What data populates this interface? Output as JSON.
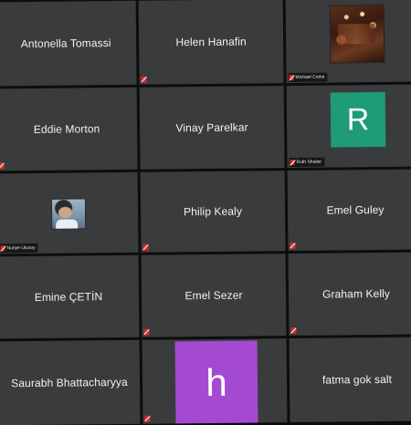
{
  "participants": [
    {
      "name": "Antonella Tomassi",
      "muted": false,
      "kind": "name"
    },
    {
      "name": "Helen Hanafin",
      "muted": true,
      "kind": "name"
    },
    {
      "name": "Michael Croke",
      "muted": true,
      "kind": "video"
    },
    {
      "name": "Eddie Morton",
      "muted": true,
      "kind": "name"
    },
    {
      "name": "Vinay Parelkar",
      "muted": false,
      "kind": "name"
    },
    {
      "name": "Ruth Shailer",
      "muted": true,
      "kind": "letter",
      "letter": "R",
      "color": "#1f9b78"
    },
    {
      "name": "Nuriye Ulusoy",
      "muted": true,
      "kind": "photo"
    },
    {
      "name": "Philip Kealy",
      "muted": true,
      "kind": "name"
    },
    {
      "name": "Emel Guley",
      "muted": true,
      "kind": "name"
    },
    {
      "name": "Emine ÇETİN",
      "muted": false,
      "kind": "name"
    },
    {
      "name": "Emel Sezer",
      "muted": true,
      "kind": "name"
    },
    {
      "name": "Graham Kelly",
      "muted": true,
      "kind": "name"
    },
    {
      "name": "Saurabh Bhattacharyya",
      "muted": false,
      "kind": "name"
    },
    {
      "name": "",
      "muted": true,
      "kind": "letter",
      "letter": "h",
      "color": "#a44ad1"
    },
    {
      "name": "fatma gok salt",
      "muted": false,
      "kind": "name"
    }
  ]
}
